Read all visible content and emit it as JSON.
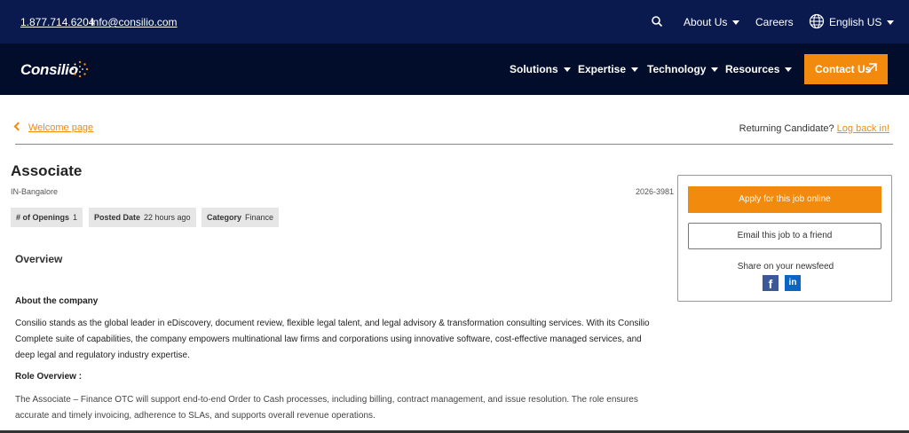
{
  "topbar": {
    "phone": "1.877.714.6204",
    "email": "info@consilio.com",
    "about": "About Us",
    "careers": "Careers",
    "language": "English US"
  },
  "nav": {
    "logo": "Consilio",
    "solutions": "Solutions",
    "expertise": "Expertise",
    "technology": "Technology",
    "resources": "Resources",
    "contact": "Contact Us"
  },
  "breadcrumb": {
    "back": "Welcome page",
    "returning": "Returning Candidate?",
    "login": "Log back in!"
  },
  "job": {
    "title": "Associate",
    "location": "IN-Bangalore",
    "req_id": "2026-3981",
    "tags": [
      {
        "label": "# of Openings",
        "value": "1"
      },
      {
        "label": "Posted Date",
        "value": "22 hours ago"
      },
      {
        "label": "Category",
        "value": "Finance"
      }
    ]
  },
  "content": {
    "overview": "Overview",
    "about_heading": "About the company",
    "about_text": "Consilio stands as the global leader in eDiscovery, document review, flexible legal talent, and legal advisory & transformation consulting services. With its Consilio Complete suite of capabilities, the company empowers multinational law firms and corporations using innovative software, cost-effective managed services, and deep legal and regulatory industry expertise.",
    "role_heading": "Role Overview :",
    "role_text": "The Associate – Finance OTC will support end-to-end Order to Cash processes, including billing, contract management, and issue resolution. The role ensures accurate and timely invoicing, adherence to SLAs, and supports overall revenue operations."
  },
  "panel": {
    "apply": "Apply for this job online",
    "email_friend": "Email this job to a friend",
    "share": "Share on your newsfeed",
    "facebook_icon": "f",
    "linkedin_icon": "in"
  },
  "colors": {
    "topbar": "#0a1a4f",
    "mainnav": "#020d2c",
    "accent": "#f28a0e"
  }
}
